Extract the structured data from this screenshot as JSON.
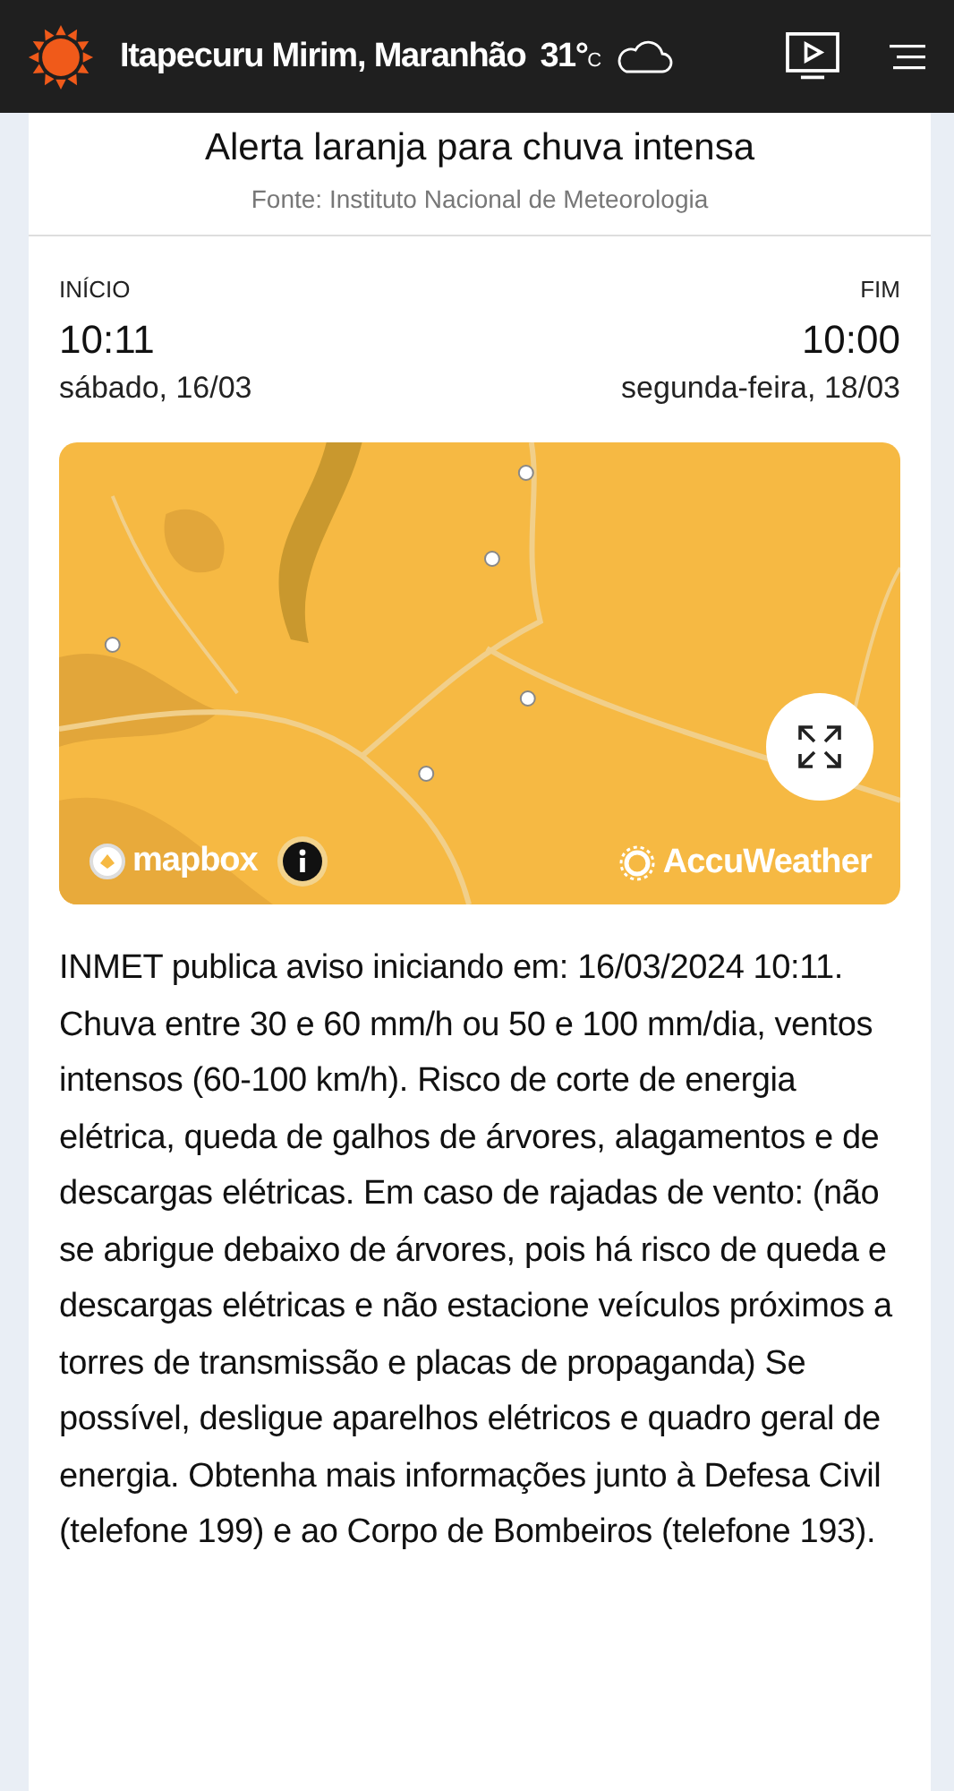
{
  "header": {
    "location": "Itapecuru Mirim, Maranhão",
    "temperature": "31°",
    "unit": "C"
  },
  "alert": {
    "title": "Alerta laranja para chuva intensa",
    "source": "Fonte: Instituto Nacional de Meteorologia"
  },
  "period": [
    {
      "label": "INÍCIO",
      "time": "10:11",
      "date": "sábado, 16/03"
    },
    {
      "label": "FIM",
      "time": "10:00",
      "date": "segunda-feira, 18/03"
    }
  ],
  "map": {
    "kind": "picture",
    "attribution": "mapbox",
    "brand": "AccuWeather"
  },
  "description": "INMET publica aviso iniciando em: 16/03/2024 10:11. Chuva entre 30 e 60 mm/h ou 50 e 100 mm/dia, ventos intensos (60-100 km/h). Risco de corte de energia elétrica, queda de galhos de árvores, alagamentos e de descargas elétricas. Em caso de rajadas de vento: (não se abrigue debaixo de árvores, pois há risco de queda e descargas elétricas e não estacione veículos próximos a torres de transmissão e placas de propaganda) Se possível, desligue aparelhos elétricos e quadro geral de energia. Obtenha mais informações junto à Defesa Civil (telefone 199) e ao Corpo de Bombeiros (telefone 193)."
}
